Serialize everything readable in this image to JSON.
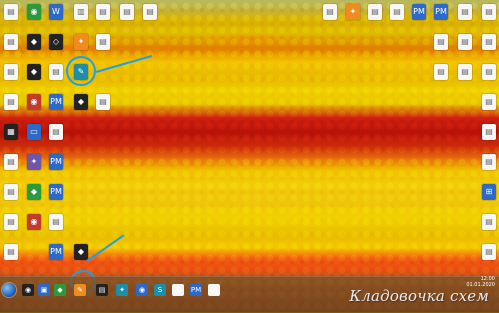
{
  "desktop": {
    "watermark": "Кладовочка схем"
  },
  "taskbar": {
    "clock_time": "12:00",
    "clock_date": "01.01.2020"
  }
}
